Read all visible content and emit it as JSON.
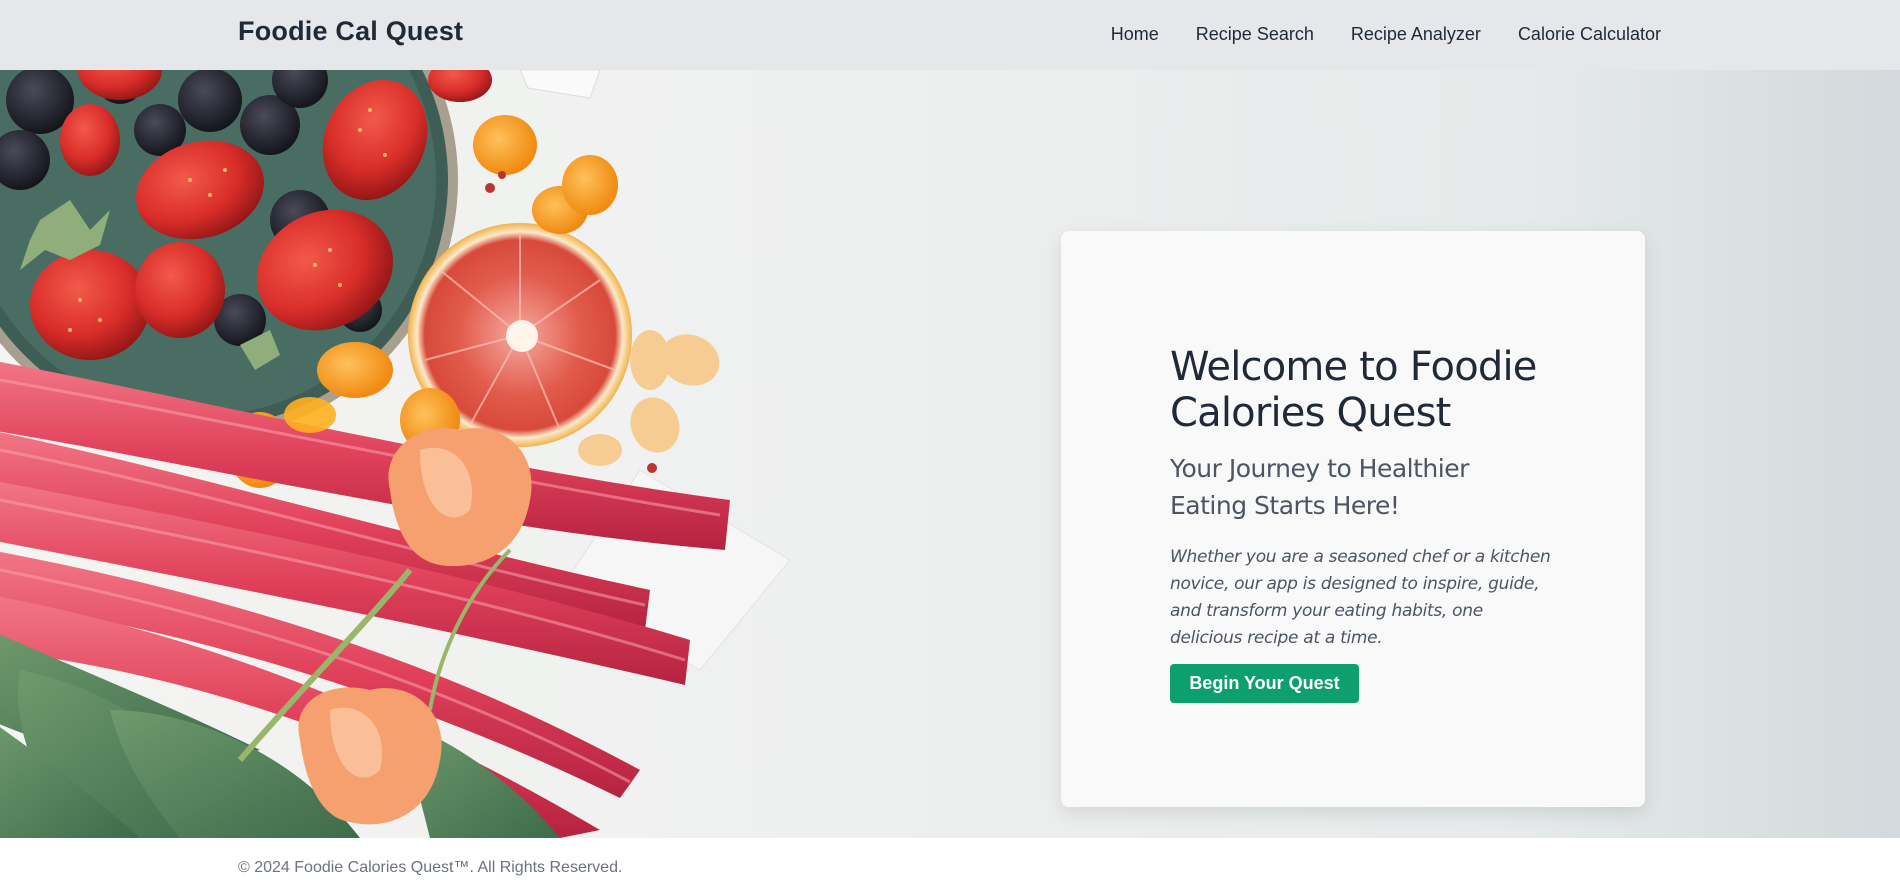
{
  "header": {
    "brand": "Foodie Cal Quest",
    "nav": [
      {
        "label": "Home"
      },
      {
        "label": "Recipe Search"
      },
      {
        "label": "Recipe Analyzer"
      },
      {
        "label": "Calorie Calculator"
      }
    ]
  },
  "hero": {
    "image_icon": "fruit-and-rhubarb-photo",
    "card": {
      "title": "Welcome to Foodie Calories Quest",
      "subtitle": "Your Journey to Healthier Eating Starts Here!",
      "text": "Whether you are a seasoned chef or a kitchen novice, our app is designed to inspire, guide, and transform your eating habits, one delicious recipe at a time.",
      "cta_label": "Begin Your Quest"
    }
  },
  "footer": {
    "copyright": "© 2024 Foodie Calories Quest™. All Rights Reserved."
  },
  "colors": {
    "navbar_bg": "#e5e7eb",
    "text_dark": "#1f2937",
    "cta_green": "#0e9f6e",
    "muted": "#6b7280"
  }
}
